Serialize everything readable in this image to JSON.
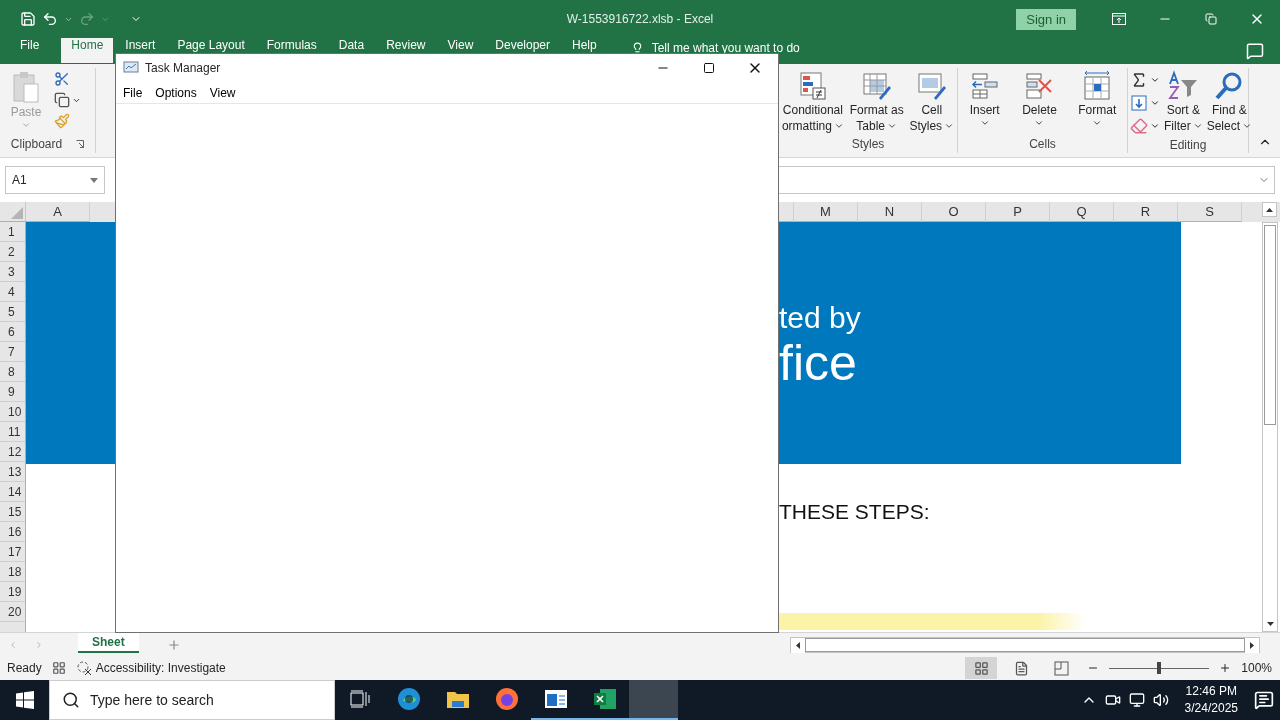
{
  "excel": {
    "title": "W-1553916722.xlsb  -  Excel",
    "sign_in": "Sign in",
    "ribbon_tabs": [
      {
        "label": "File",
        "selected": false
      },
      {
        "label": "Home",
        "selected": true
      },
      {
        "label": "Insert",
        "selected": false
      },
      {
        "label": "Page Layout",
        "selected": false
      },
      {
        "label": "Formulas",
        "selected": false
      },
      {
        "label": "Data",
        "selected": false
      },
      {
        "label": "Review",
        "selected": false
      },
      {
        "label": "View",
        "selected": false
      },
      {
        "label": "Developer",
        "selected": false
      },
      {
        "label": "Help",
        "selected": false
      }
    ],
    "tell_me": "Tell me what you want to do",
    "clipboard": {
      "paste": "Paste",
      "label": "Clipboard"
    },
    "groups": [
      {
        "label": "Styles",
        "buttons": [
          {
            "kind": "conditional",
            "lines": [
              "Conditional",
              "ormatting"
            ],
            "caret": true
          },
          {
            "kind": "table",
            "lines": [
              "Format as",
              "Table"
            ],
            "caret": true
          },
          {
            "kind": "cell-styles",
            "lines": [
              "Cell",
              "Styles"
            ],
            "caret": true
          }
        ]
      },
      {
        "label": "Cells",
        "buttons": [
          {
            "kind": "insert",
            "lines": [
              "Insert"
            ],
            "caret": true
          },
          {
            "kind": "delete",
            "lines": [
              "Delete"
            ],
            "caret": true
          },
          {
            "kind": "format",
            "lines": [
              "Format"
            ],
            "caret": true
          }
        ]
      },
      {
        "label": "Editing",
        "buttons": [
          {
            "kind": "tools"
          },
          {
            "kind": "sort",
            "lines": [
              "Sort &",
              "Filter"
            ],
            "caret": true
          },
          {
            "kind": "find",
            "lines": [
              "Find &",
              "Select"
            ],
            "caret": true
          }
        ]
      }
    ],
    "name_box": "A1",
    "columns_left": [
      "A"
    ],
    "columns_right": [
      "M",
      "N",
      "O",
      "P",
      "Q",
      "R",
      "S"
    ],
    "rows": [
      "1",
      "2",
      "3",
      "4",
      "5",
      "6",
      "7",
      "8",
      "9",
      "10",
      "11",
      "12",
      "13",
      "14",
      "15",
      "16",
      "17",
      "18",
      "19",
      "20"
    ],
    "banner_lines": [
      "ted by",
      "fice"
    ],
    "steps_heading": "THESE STEPS:",
    "sheet_tab": {
      "label": "Sheet",
      "selected": true
    },
    "status": {
      "ready": "Ready",
      "accessibility": "Accessibility: Investigate",
      "views": [
        {
          "kind": "normal",
          "selected": true
        },
        {
          "kind": "page-layout",
          "selected": false
        },
        {
          "kind": "page-break",
          "selected": false
        }
      ],
      "zoom": {
        "level": 0.5,
        "reading": "100%"
      }
    }
  },
  "task_manager": {
    "title": "Task Manager",
    "menu": [
      "File",
      "Options",
      "View"
    ]
  },
  "taskbar": {
    "search_placeholder": "Type here to search",
    "apps": [
      {
        "kind": "edge",
        "running": false,
        "selected": false
      },
      {
        "kind": "explorer",
        "running": false,
        "selected": false
      },
      {
        "kind": "firefox",
        "running": false,
        "selected": false
      },
      {
        "kind": "window-app",
        "running": true,
        "selected": false
      },
      {
        "kind": "excel",
        "running": true,
        "selected": false
      },
      {
        "kind": "blank",
        "running": true,
        "selected": true
      }
    ],
    "time": "12:46 PM",
    "date": "3/24/2025"
  }
}
